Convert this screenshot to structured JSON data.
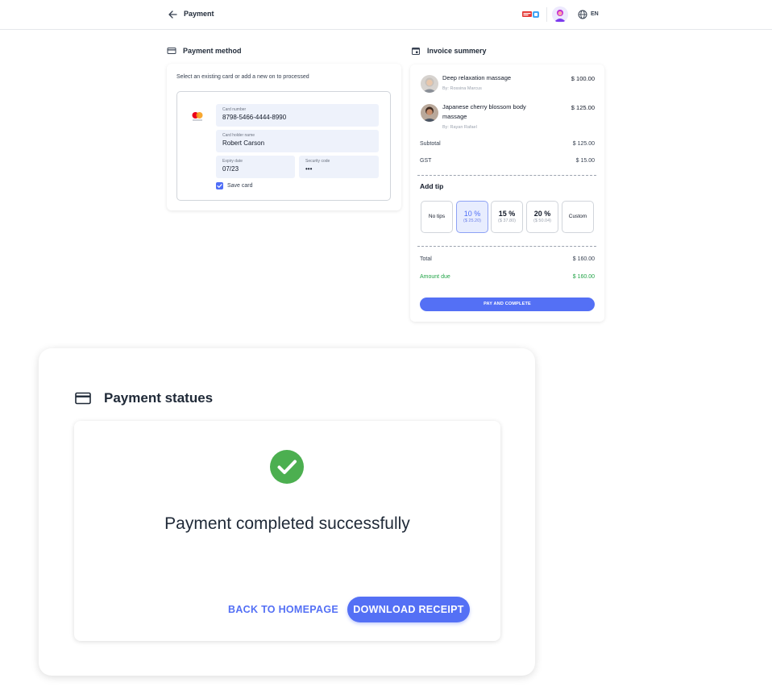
{
  "header": {
    "title": "Payment",
    "language": "EN"
  },
  "payment_method": {
    "heading": "Payment method",
    "instruction": "Select an existing card or add a new on to processed",
    "card_number_label": "Card number",
    "card_number": "8798-5466-4444-8990",
    "holder_label": "Card holder name",
    "holder_name": "Robert Carson",
    "expiry_label": "Expiry date",
    "expiry": "07/23",
    "security_label": "Security code",
    "security": "•••",
    "save_card_label": "Save card",
    "save_card_checked": true
  },
  "invoice": {
    "heading": "Invoice summery",
    "items": [
      {
        "name": "Deep relaxation massage",
        "by": "By: Rossina Marcus",
        "price": "$ 100.00"
      },
      {
        "name": "Japanese cherry blossom body massage",
        "by": "By: Rayan Rafael",
        "price": "$ 125.00"
      }
    ],
    "subtotal_label": "Subtotal",
    "subtotal": "$ 125.00",
    "gst_label": "GST",
    "gst": "$ 15.00",
    "tip_title": "Add tip",
    "tips": [
      {
        "label": "No tips"
      },
      {
        "pct": "10 %",
        "amt": "($ 25.20)",
        "selected": true
      },
      {
        "pct": "15 %",
        "amt": "($ 37.80)"
      },
      {
        "pct": "20 %",
        "amt": "($ 50.04)"
      },
      {
        "label": "Custom"
      }
    ],
    "total_label": "Total",
    "total": "$ 160.00",
    "amount_due_label": "Amount due",
    "amount_due": "$ 160.00",
    "pay_button": "PAY AND COMPLETE"
  },
  "modal": {
    "heading": "Payment statues",
    "message": "Payment completed successfully",
    "back_link": "BACK TO HOMEPAGE",
    "download_button": "DOWNLOAD RECEIPT"
  },
  "colors": {
    "accent": "#5470f5",
    "success": "#4caf50",
    "amount_due": "#22a447"
  }
}
